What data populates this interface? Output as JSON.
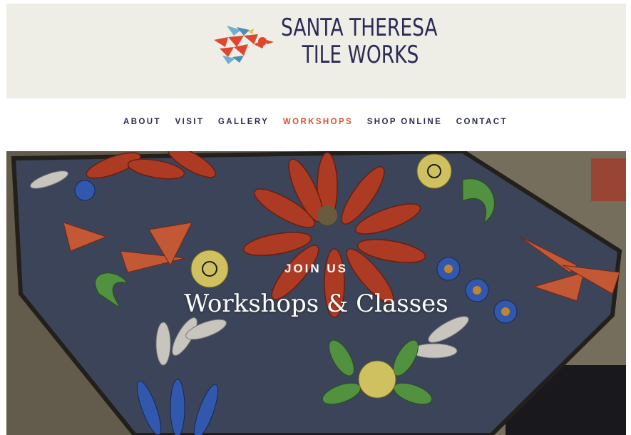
{
  "brand": {
    "line1": "SANTA THERESA",
    "line2": "TILE WORKS",
    "logo_icon": "bird-icon",
    "colors": {
      "bird_red": "#e1462d",
      "bird_blue": "#6fb0d2",
      "text": "#2b2b55"
    }
  },
  "nav": {
    "items": [
      {
        "label": "ABOUT",
        "active": false
      },
      {
        "label": "VISIT",
        "active": false
      },
      {
        "label": "GALLERY",
        "active": false
      },
      {
        "label": "WORKSHOPS",
        "active": true
      },
      {
        "label": "SHOP ONLINE",
        "active": false
      },
      {
        "label": "CONTACT",
        "active": false
      }
    ],
    "active_color": "#d9532e"
  },
  "hero": {
    "eyebrow": "JOIN US",
    "title": "Workshops & Classes"
  }
}
